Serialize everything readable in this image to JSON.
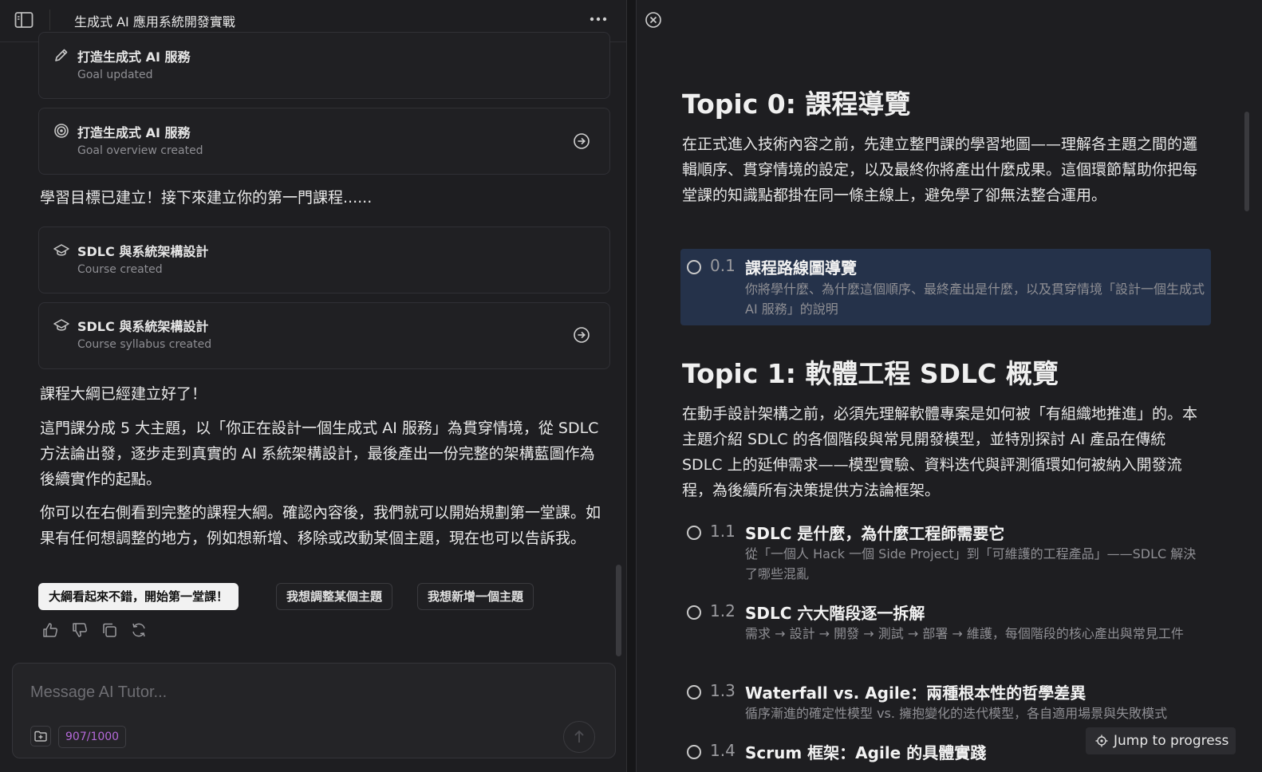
{
  "header": {
    "title": "生成式 AI 應用系統開發實戰"
  },
  "timeline": [
    {
      "title": "打造生成式 AI 服務",
      "subtitle": "Goal updated",
      "icon": "pencil-icon"
    },
    {
      "title": "打造生成式 AI 服務",
      "subtitle": "Goal overview created",
      "icon": "target-icon"
    },
    {
      "title": "SDLC 與系統架構設計",
      "subtitle": "Course created",
      "icon": "graduation-cap-icon"
    },
    {
      "title": "SDLC 與系統架構設計",
      "subtitle": "Course syllabus created",
      "icon": "graduation-cap-icon"
    }
  ],
  "messages": {
    "goal_done": "學習目標已建立！接下來建立你的第一門課程......",
    "syllabus_done": "課程大綱已經建立好了！",
    "summary": "這門課分成 5 大主題，以「你正在設計一個生成式 AI 服務」為貫穿情境，從 SDLC 方法論出發，逐步走到真實的 AI 系統架構設計，最後產出一份完整的架構藍圖作為後續實作的起點。",
    "next_step": "你可以在右側看到完整的課程大綱。確認內容後，我們就可以開始規劃第一堂課。如果有任何想調整的地方，例如想新增、移除或改動某個主題，現在也可以告訴我。"
  },
  "quick_replies": [
    "大綱看起來不錯，開始第一堂課！",
    "我想調整某個主題",
    "我想新增一個主題"
  ],
  "composer": {
    "placeholder": "Message AI Tutor...",
    "counter": "907/1000"
  },
  "syllabus": {
    "topics": [
      {
        "title": "Topic 0: 課程導覽",
        "description": "在正式進入技術內容之前，先建立整門課的學習地圖——理解各主題之間的邏輯順序、貫穿情境的設定，以及最終你將產出什麼成果。這個環節幫助你把每堂課的知識點都掛在同一條主線上，避免學了卻無法整合運用。",
        "lessons": [
          {
            "num": "0.1",
            "title": "課程路線圖導覽",
            "desc": "你將學什麼、為什麼這個順序、最終產出是什麼，以及貫穿情境「設計一個生成式 AI 服務」的說明"
          }
        ]
      },
      {
        "title": "Topic 1: 軟體工程 SDLC 概覽",
        "description": "在動手設計架構之前，必須先理解軟體專案是如何被「有組織地推進」的。本主題介紹 SDLC 的各個階段與常見開發模型，並特別探討 AI 產品在傳統 SDLC 上的延伸需求——模型實驗、資料迭代與評測循環如何被納入開發流程，為後續所有決策提供方法論框架。",
        "lessons": [
          {
            "num": "1.1",
            "title": "SDLC 是什麼，為什麼工程師需要它",
            "desc": "從「一個人 Hack 一個 Side Project」到「可維護的工程產品」——SDLC 解決了哪些混亂"
          },
          {
            "num": "1.2",
            "title": "SDLC 六大階段逐一拆解",
            "desc": "需求 → 設計 → 開發 → 測試 → 部署 → 維護，每個階段的核心產出與常見工件"
          },
          {
            "num": "1.3",
            "title": "Waterfall vs. Agile：兩種根本性的哲學差異",
            "desc": "循序漸進的確定性模型 vs. 擁抱變化的迭代模型，各自適用場景與失敗模式"
          },
          {
            "num": "1.4",
            "title": "Scrum 框架：Agile 的具體實踐",
            "desc": ""
          }
        ]
      }
    ]
  },
  "jump_button": "Jump to progress"
}
